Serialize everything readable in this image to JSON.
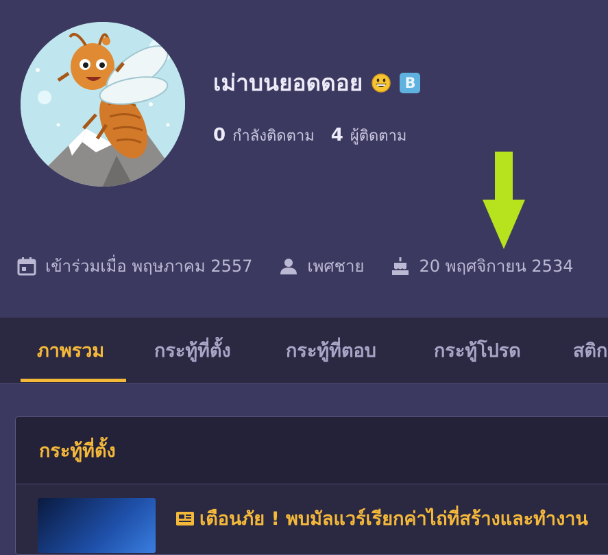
{
  "profile": {
    "name": "เม่าบนยอดดอย",
    "emoji_icon": "grinning-face-emoji",
    "badge_letter": "B",
    "following_count": "0",
    "following_label": "กำลังติดตาม",
    "followers_count": "4",
    "followers_label": "ผู้ติดตาม",
    "joined": "เข้าร่วมเมื่อ พฤษภาคม 2557",
    "gender": "เพศชาย",
    "birthday": "20 พฤศจิกายน 2534"
  },
  "tabs": [
    {
      "label": "ภาพรวม",
      "active": true
    },
    {
      "label": "กระทู้ที่ตั้ง",
      "active": false
    },
    {
      "label": "กระทู้ที่ตอบ",
      "active": false
    },
    {
      "label": "กระทู้โปรด",
      "active": false
    },
    {
      "label": "สติกเกอร์",
      "active": false
    }
  ],
  "section": {
    "title": "กระทู้ที่ตั้ง",
    "topics": [
      {
        "title": "เตือนภัย ! พบมัลแวร์เรียกค่าไถ่ที่สร้างและทำงาน",
        "icon": "newspaper-icon"
      }
    ]
  },
  "colors": {
    "background": "#3c3960",
    "tabbar": "#2b2942",
    "accent": "#f5b93a",
    "arrow": "#b6e31d",
    "badge": "#5fb2df"
  }
}
